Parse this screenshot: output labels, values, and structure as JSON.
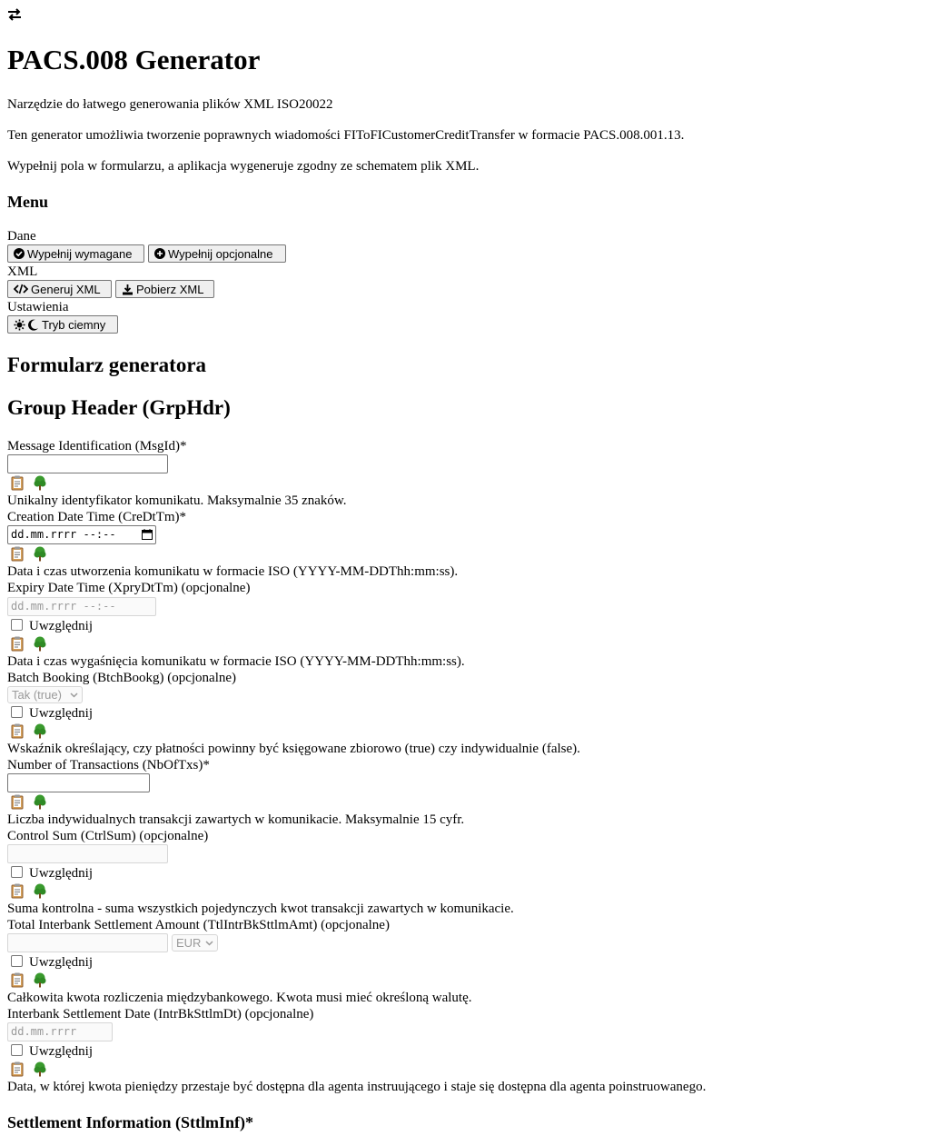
{
  "header": {
    "swap_icon": "swap-arrows-icon",
    "title": "PACS.008 Generator",
    "subtitle": "Narzędzie do łatwego generowania plików XML ISO20022",
    "description1": "Ten generator umożliwia tworzenie poprawnych wiadomości FIToFICustomerCreditTransfer w formacie PACS.008.001.13.",
    "description2": "Wypełnij pola w formularzu, a aplikacja wygeneruje zgodny ze schematem plik XML."
  },
  "menu": {
    "title": "Menu",
    "dane_label": "Dane",
    "fill_required": "Wypełnij wymagane",
    "fill_optional": "Wypełnij opcjonalne",
    "xml_label": "XML",
    "generate_xml": "Generuj XML",
    "download_xml": "Pobierz XML",
    "settings_label": "Ustawienia",
    "dark_mode": "Tryb ciemny"
  },
  "form": {
    "title": "Formularz generatora",
    "group_header_title": "Group Header (GrpHdr)",
    "include_label": "Uwzględnij",
    "fields": {
      "msgid": {
        "label": "Message Identification (MsgId)*",
        "value": "",
        "help": "Unikalny identyfikator komunikatu. Maksymalnie 35 znaków."
      },
      "credttm": {
        "label": "Creation Date Time (CreDtTm)*",
        "placeholder": "dd.mm.rrrr --:--",
        "help": "Data i czas utworzenia komunikatu w formacie ISO (YYYY-MM-DDThh:mm:ss)."
      },
      "xprydttm": {
        "label": "Expiry Date Time (XpryDtTm) (opcjonalne)",
        "placeholder": "dd.mm.rrrr --:--",
        "help": "Data i czas wygaśnięcia komunikatu w formacie ISO (YYYY-MM-DDThh:mm:ss)."
      },
      "btchbookg": {
        "label": "Batch Booking (BtchBookg) (opcjonalne)",
        "selected": "Tak (true)",
        "help": "Wskaźnik określający, czy płatności powinny być księgowane zbiorowo (true) czy indywidualnie (false)."
      },
      "nboftxs": {
        "label": "Number of Transactions (NbOfTxs)*",
        "value": "",
        "help": "Liczba indywidualnych transakcji zawartych w komunikacie. Maksymalnie 15 cyfr."
      },
      "ctrlsum": {
        "label": "Control Sum (CtrlSum) (opcjonalne)",
        "value": "",
        "help": "Suma kontrolna - suma wszystkich pojedynczych kwot transakcji zawartych w komunikacie."
      },
      "ttlintrbksttlmamt": {
        "label": "Total Interbank Settlement Amount (TtlIntrBkSttlmAmt) (opcjonalne)",
        "value": "",
        "currency": "EUR",
        "help": "Całkowita kwota rozliczenia międzybankowego. Kwota musi mieć określoną walutę."
      },
      "intrbksttlmdt": {
        "label": "Interbank Settlement Date (IntrBkSttlmDt) (opcjonalne)",
        "placeholder": "dd.mm.rrrr",
        "help": "Data, w której kwota pieniędzy przestaje być dostępna dla agenta instruującego i staje się dostępna dla agenta poinstruowanego."
      }
    },
    "settlement_title": "Settlement Information (SttlmInf)*"
  },
  "icons": {
    "clipboard": "clipboard-icon",
    "tree": "tree-icon"
  }
}
